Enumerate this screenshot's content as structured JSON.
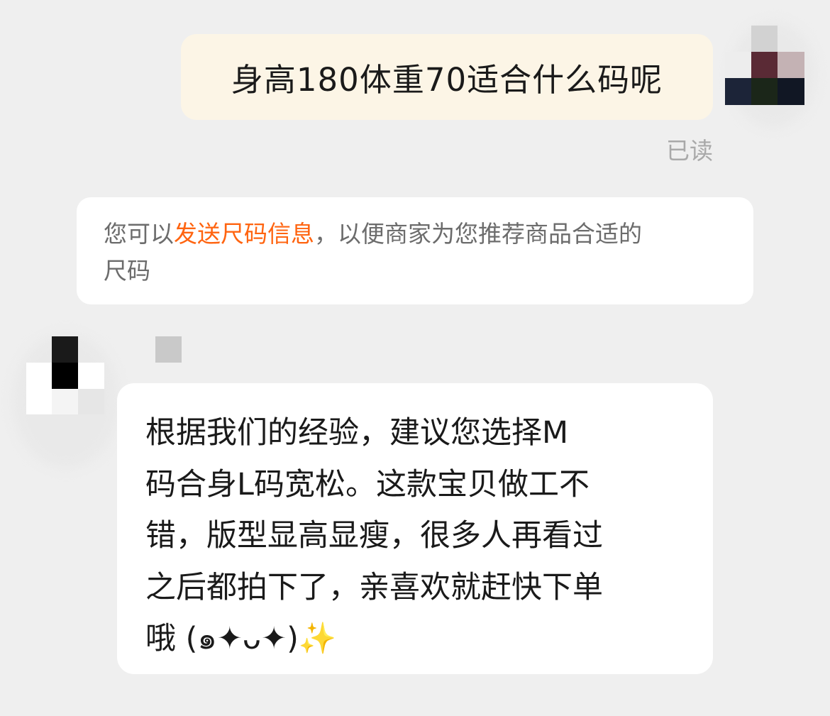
{
  "user_message": {
    "text": "身高180体重70适合什么码呢",
    "read_status": "已读"
  },
  "system_hint": {
    "prefix": "您可以",
    "link": "发送尺码信息",
    "suffix_line1": "，以便商家为您推荐商品合适的",
    "suffix_line2": "尺码"
  },
  "merchant_message": {
    "lines": [
      "根据我们的经验，建议您选择M",
      "码合身L码宽松。这款宝贝做工不",
      "错，版型显高显瘦，很多人再看过",
      "之后都拍下了，亲喜欢就赶快下单"
    ],
    "last_line_text": "哦 (๑✦ᴗ✦)",
    "emoji": "✨"
  },
  "colors": {
    "background": "#efefef",
    "user_bubble": "#fcf5e6",
    "merchant_bubble": "#ffffff",
    "link_orange": "#ff6410",
    "read_gray": "#a9a9a9"
  },
  "icons": {
    "user_avatar": "pixelated-avatar",
    "merchant_avatar": "pixelated-avatar",
    "sparkle": "sparkles-emoji"
  }
}
